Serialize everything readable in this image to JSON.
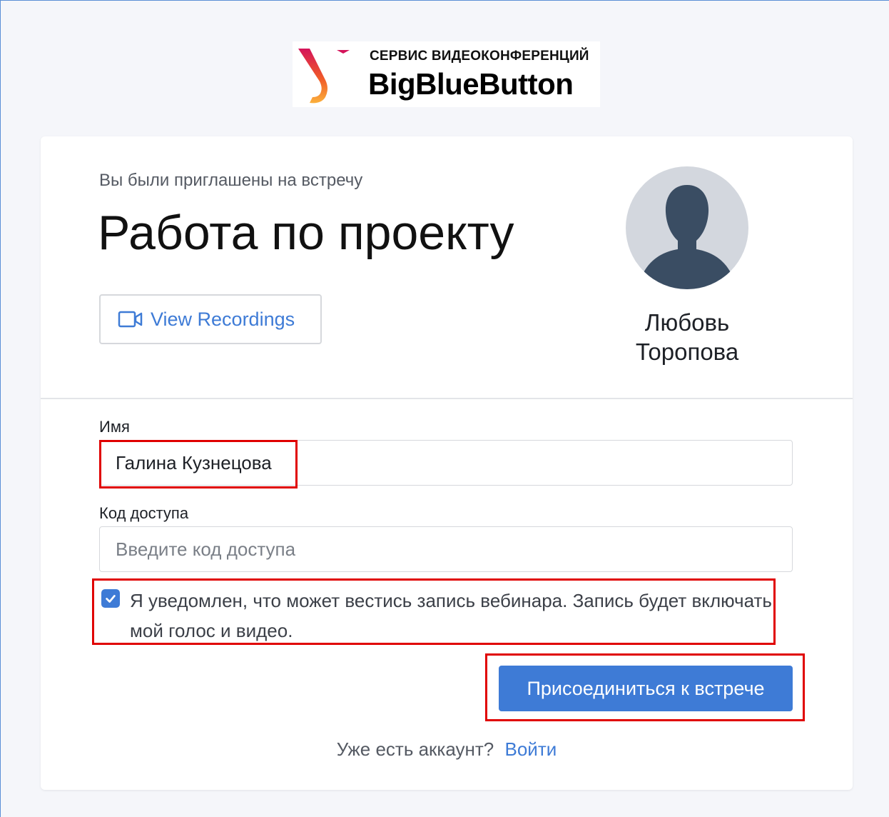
{
  "logo": {
    "subtitle": "СЕРВИС ВИДЕОКОНФЕРЕНЦИЙ",
    "title": "BigBlueButton"
  },
  "room": {
    "invite_text": "Вы были приглашены на встречу",
    "name": "Работа по проекту",
    "view_recordings_label": "View Recordings",
    "owner_name": "Любовь Торопова"
  },
  "form": {
    "name_label": "Имя",
    "name_value": "Галина Кузнецова",
    "access_code_label": "Код доступа",
    "access_code_placeholder": "Введите код доступа",
    "consent_checked": true,
    "consent_text": "Я уведомлен, что может вестись запись вебинара. Запись будет включать мой голос и видео.",
    "join_button_label": "Присоединиться к встрече"
  },
  "footer": {
    "question": "Уже есть аккаунт?",
    "login_link": "Войти"
  },
  "colors": {
    "accent": "#3e7bd6",
    "highlight": "#e00000"
  }
}
